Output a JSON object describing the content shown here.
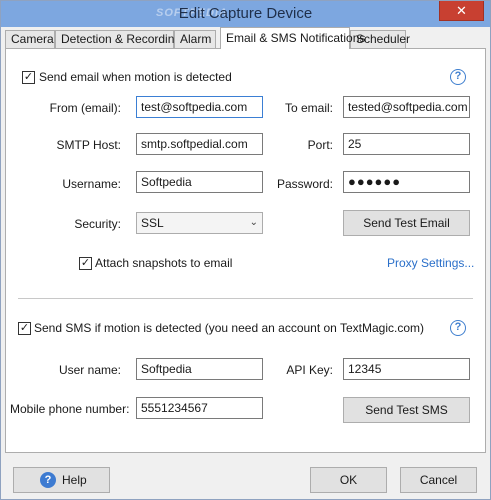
{
  "window": {
    "title": "Edit Capture Device",
    "close_glyph": "✕",
    "watermark": "SOFTPEDIA"
  },
  "tabs": [
    {
      "label": "Camera",
      "active": false
    },
    {
      "label": "Detection & Recording",
      "active": false
    },
    {
      "label": "Alarm",
      "active": false
    },
    {
      "label": "Email & SMS Notifications",
      "active": true
    },
    {
      "label": "Scheduler",
      "active": false
    }
  ],
  "email": {
    "send_email_label": "Send email when motion is detected",
    "send_email_checked": true,
    "from_label": "From (email):",
    "from_value": "test@softpedia.com",
    "to_label": "To email:",
    "to_value": "tested@softpedia.com",
    "smtp_label": "SMTP Host:",
    "smtp_value": "smtp.softpedial.com",
    "port_label": "Port:",
    "port_value": "25",
    "username_label": "Username:",
    "username_value": "Softpedia",
    "password_label": "Password:",
    "password_value": "●●●●●●",
    "security_label": "Security:",
    "security_value": "SSL",
    "send_test_email_label": "Send Test Email",
    "attach_label": "Attach snapshots to email",
    "attach_checked": true,
    "proxy_label": "Proxy Settings..."
  },
  "sms": {
    "send_sms_label": "Send SMS if motion is detected (you need an account on TextMagic.com)",
    "send_sms_checked": true,
    "user_label": "User name:",
    "user_value": "Softpedia",
    "api_label": "API Key:",
    "api_value": "12345",
    "mobile_label": "Mobile phone number:",
    "mobile_value": "5551234567",
    "send_test_sms_label": "Send Test SMS"
  },
  "footer": {
    "help_label": "Help",
    "ok_label": "OK",
    "cancel_label": "Cancel"
  },
  "glyphs": {
    "check": "✓",
    "help": "?",
    "chevron": "⌄"
  },
  "colors": {
    "title_bar": "#7da7e0",
    "close_button": "#c84031",
    "link": "#2a6fc9",
    "help_icon": "#3f7fcf"
  }
}
